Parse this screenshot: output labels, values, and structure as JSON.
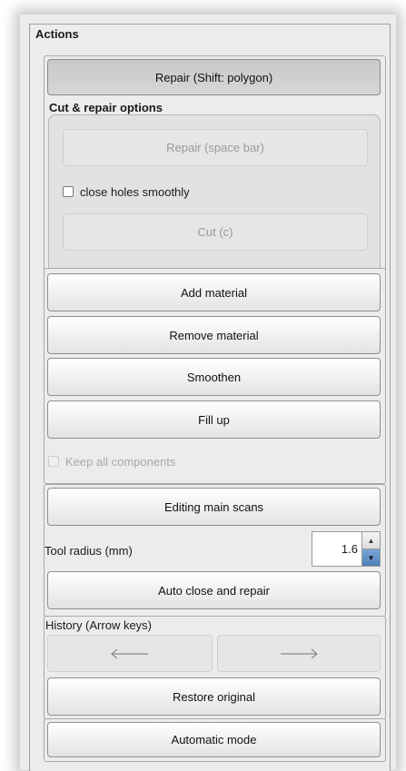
{
  "panel": {
    "title": "Actions"
  },
  "repair_button": {
    "label": "Repair (Shift: polygon)"
  },
  "cut_repair": {
    "title": "Cut & repair options",
    "repair_label": "Repair (space bar)",
    "close_holes_label": "close holes smoothly",
    "cut_label": "Cut (c)"
  },
  "material": {
    "add_label": "Add material",
    "remove_label": "Remove material",
    "smoothen_label": "Smoothen",
    "fill_label": "Fill up",
    "keep_components_label": "Keep all components"
  },
  "editing": {
    "main_scans_label": "Editing main scans",
    "tool_radius_label": "Tool radius (mm)",
    "tool_radius_value": "1.6",
    "auto_close_label": "Auto close and repair"
  },
  "history": {
    "title": "History (Arrow keys)",
    "back_icon": "left-arrow-icon",
    "forward_icon": "right-arrow-icon",
    "restore_label": "Restore original"
  },
  "automatic_label": "Automatic mode"
}
